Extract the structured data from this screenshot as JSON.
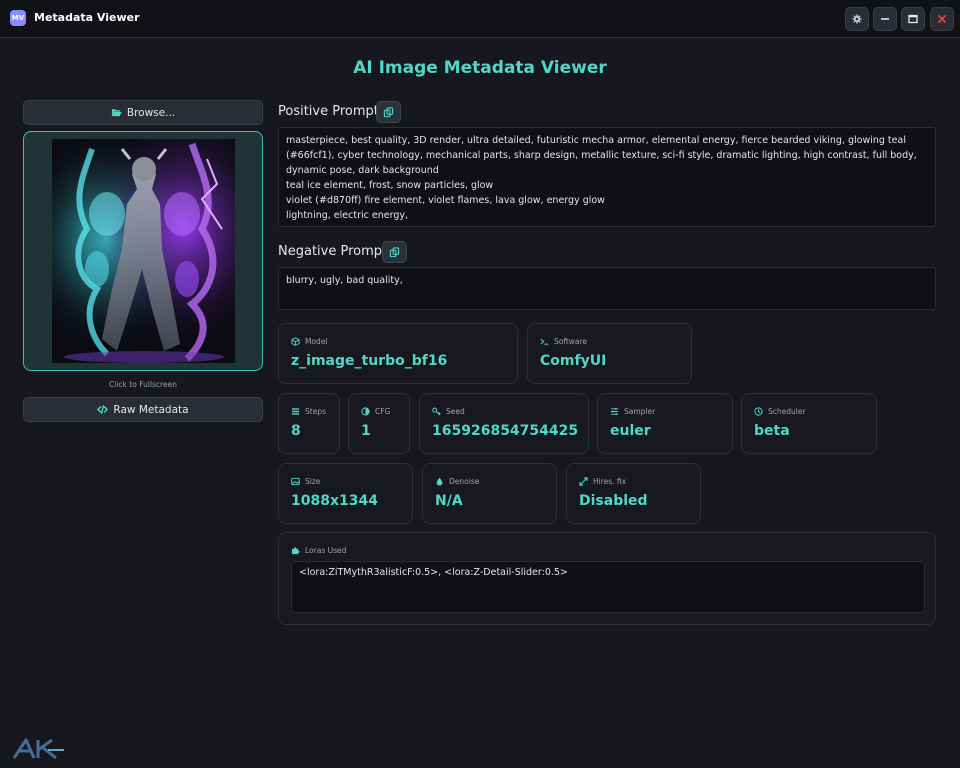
{
  "window": {
    "app_icon_text": "MV",
    "title": "Metadata Viewer"
  },
  "header": {
    "title": "AI Image Metadata Viewer"
  },
  "left_panel": {
    "browse_label": "Browse...",
    "image_caption": "Click to Fullscreen",
    "raw_metadata_label": "Raw Metadata"
  },
  "prompts": {
    "positive_label": "Positive Prompt",
    "positive_text": "masterpiece, best quality, 3D render, ultra detailed, futuristic mecha armor, elemental energy, fierce bearded viking, glowing teal (#66fcf1), cyber technology, mechanical parts, sharp design, metallic texture, sci-fi style, dramatic lighting, high contrast, full body, dynamic pose, dark background\nteal ice element, frost, snow particles, glow\nviolet (#d870ff) fire element, violet flames, lava glow, energy glow\nlightning, electric energy,",
    "negative_label": "Negative Prompt",
    "negative_text": "blurry, ugly, bad quality,"
  },
  "metadata": {
    "model": {
      "label": "Model",
      "value": "z_image_turbo_bf16",
      "icon": "cube-icon"
    },
    "software": {
      "label": "Software",
      "value": "ComfyUI",
      "icon": "terminal-icon"
    },
    "steps": {
      "label": "Steps",
      "value": "8",
      "icon": "layers-icon"
    },
    "cfg": {
      "label": "CFG",
      "value": "1",
      "icon": "half-circle-icon"
    },
    "seed": {
      "label": "Seed",
      "value": "165926854754425",
      "icon": "key-icon"
    },
    "sampler": {
      "label": "Sampler",
      "value": "euler",
      "icon": "sliders-icon"
    },
    "scheduler": {
      "label": "Scheduler",
      "value": "beta",
      "icon": "clock-icon"
    },
    "size": {
      "label": "Size",
      "value": "1088x1344",
      "icon": "image-icon"
    },
    "denoise": {
      "label": "Denoise",
      "value": "N/A",
      "icon": "droplet-icon"
    },
    "hires": {
      "label": "Hires. fix",
      "value": "Disabled",
      "icon": "expand-icon"
    }
  },
  "loras": {
    "label": "Loras Used",
    "value": "<lora:ZiTMythR3alisticF:0.5>, <lora:Z-Detail-Slider:0.5>"
  },
  "colors": {
    "accent": "#52d6c8",
    "background": "#16181d",
    "close": "#e0443a"
  }
}
